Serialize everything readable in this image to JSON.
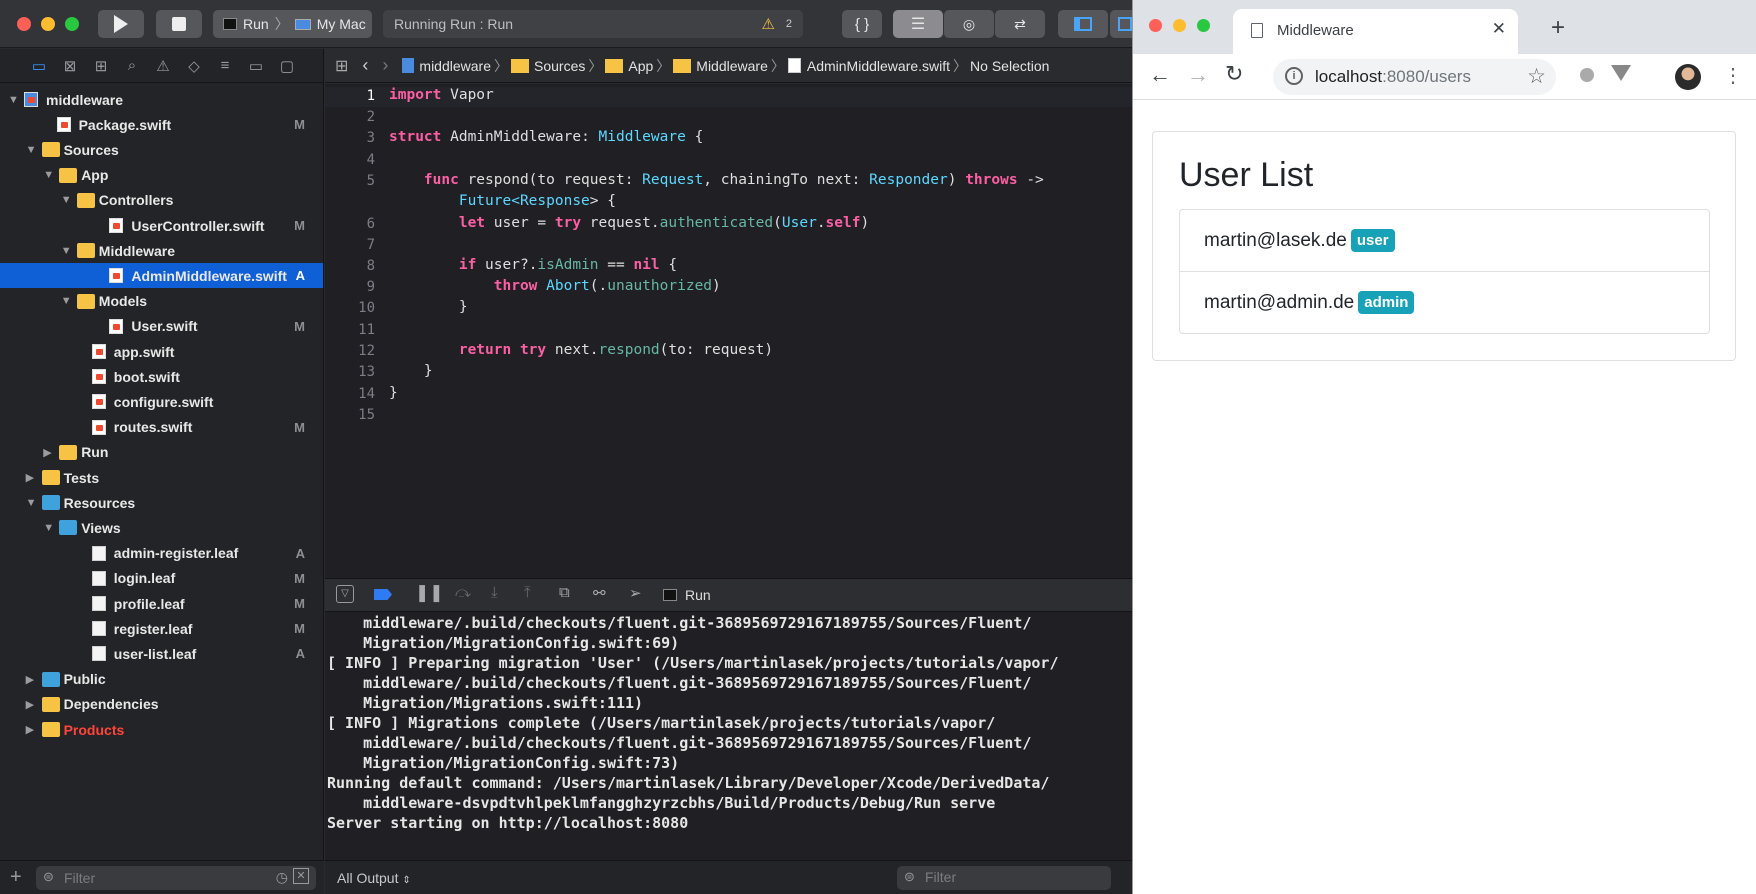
{
  "xcode": {
    "toolbar": {
      "scheme": "Run",
      "destination": "My Mac",
      "activity": "Running Run : Run",
      "warning_count": "2"
    },
    "navigator": {
      "items": [
        {
          "label": "middleware",
          "badge": ""
        },
        {
          "label": "Package.swift",
          "badge": "M"
        },
        {
          "label": "Sources",
          "badge": ""
        },
        {
          "label": "App",
          "badge": ""
        },
        {
          "label": "Controllers",
          "badge": ""
        },
        {
          "label": "UserController.swift",
          "badge": "M"
        },
        {
          "label": "Middleware",
          "badge": ""
        },
        {
          "label": "AdminMiddleware.swift",
          "badge": "A"
        },
        {
          "label": "Models",
          "badge": ""
        },
        {
          "label": "User.swift",
          "badge": "M"
        },
        {
          "label": "app.swift",
          "badge": ""
        },
        {
          "label": "boot.swift",
          "badge": ""
        },
        {
          "label": "configure.swift",
          "badge": ""
        },
        {
          "label": "routes.swift",
          "badge": "M"
        },
        {
          "label": "Run",
          "badge": ""
        },
        {
          "label": "Tests",
          "badge": ""
        },
        {
          "label": "Resources",
          "badge": ""
        },
        {
          "label": "Views",
          "badge": ""
        },
        {
          "label": "admin-register.leaf",
          "badge": "A"
        },
        {
          "label": "login.leaf",
          "badge": "M"
        },
        {
          "label": "profile.leaf",
          "badge": "M"
        },
        {
          "label": "register.leaf",
          "badge": "M"
        },
        {
          "label": "user-list.leaf",
          "badge": "A"
        },
        {
          "label": "Public",
          "badge": ""
        },
        {
          "label": "Dependencies",
          "badge": ""
        },
        {
          "label": "Products",
          "badge": ""
        }
      ],
      "filter_placeholder": "Filter"
    },
    "jumpbar": {
      "crumbs": [
        "middleware",
        "Sources",
        "App",
        "Middleware",
        "AdminMiddleware.swift",
        "No Selection"
      ]
    },
    "editor": {
      "line_numbers": [
        "1",
        "2",
        "3",
        "4",
        "5",
        "",
        "6",
        "7",
        "8",
        "9",
        "10",
        "11",
        "12",
        "13",
        "14",
        "15"
      ],
      "code": {
        "l1a": "import",
        "l1b": " Vapor",
        "l3a": "struct",
        "l3b": " AdminMiddleware: ",
        "l3c": "Middleware",
        "l3d": " {",
        "l5a": "    func",
        "l5b": " respond(to request: ",
        "l5c": "Request",
        "l5d": ", chainingTo next: ",
        "l5e": "Responder",
        "l5f": ") ",
        "l5g": "throws",
        "l5h": " ->",
        "l5wa": "        Future<",
        "l5wb": "Response",
        "l5wc": "> {",
        "l6a": "        let",
        "l6b": " user = ",
        "l6c": "try",
        "l6d": " request.",
        "l6e": "authenticated",
        "l6f": "(",
        "l6g": "User",
        "l6h": ".",
        "l6i": "self",
        "l6j": ")",
        "l8a": "        if",
        "l8b": " user?.",
        "l8c": "isAdmin",
        "l8d": " == ",
        "l8e": "nil",
        "l8f": " {",
        "l9a": "            throw",
        "l9b": " ",
        "l9c": "Abort",
        "l9d": "(.",
        "l9e": "unauthorized",
        "l9f": ")",
        "l10": "        }",
        "l12a": "        return",
        "l12b": " ",
        "l12c": "try",
        "l12d": " next.",
        "l12e": "respond",
        "l12f": "(to: request)",
        "l13": "    }",
        "l14": "}"
      }
    },
    "debugbar": {
      "target": "Run"
    },
    "console": {
      "lines": [
        "    middleware/.build/checkouts/fluent.git-3689569729167189755/Sources/Fluent/",
        "    Migration/MigrationConfig.swift:69)",
        "[ INFO ] Preparing migration 'User' (/Users/martinlasek/projects/tutorials/vapor/",
        "    middleware/.build/checkouts/fluent.git-3689569729167189755/Sources/Fluent/",
        "    Migration/Migrations.swift:111)",
        "[ INFO ] Migrations complete (/Users/martinlasek/projects/tutorials/vapor/",
        "    middleware/.build/checkouts/fluent.git-3689569729167189755/Sources/Fluent/",
        "    Migration/MigrationConfig.swift:73)",
        "Running default command: /Users/martinlasek/Library/Developer/Xcode/DerivedData/",
        "    middleware-dsvpdtvhlpeklmfangghzyrzcbhs/Build/Products/Debug/Run serve",
        "Server starting on http://localhost:8080"
      ],
      "output_selector": "All Output",
      "filter_placeholder": "Filter"
    }
  },
  "browser": {
    "tab_title": "Middleware",
    "url_host": "localhost",
    "url_rest": ":8080/users",
    "page": {
      "heading": "User List",
      "users": [
        {
          "email": "martin@lasek.de",
          "role": "user"
        },
        {
          "email": "martin@admin.de",
          "role": "admin"
        }
      ]
    }
  },
  "colors": {
    "selection": "#0f5fd6",
    "badge": "#17a2b8",
    "products": "#ff453a"
  }
}
